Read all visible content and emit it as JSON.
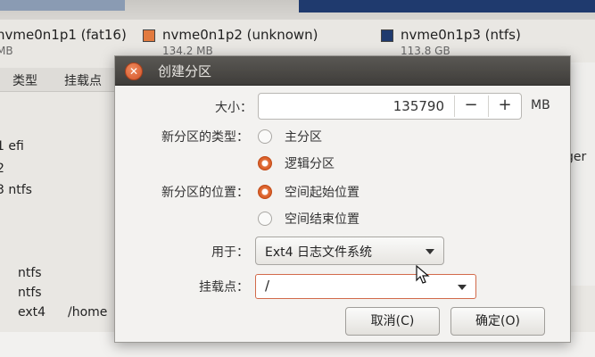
{
  "background": {
    "legend": [
      {
        "name": "nvme0n1p1 (fat16)",
        "size": "MB",
        "color": ""
      },
      {
        "name": "nvme0n1p2 (unknown)",
        "size": "134.2 MB",
        "color": "#e27a3f"
      },
      {
        "name": "nvme0n1p3 (ntfs)",
        "size": "113.8 GB",
        "color": "#1f3a6e"
      }
    ],
    "columns": [
      "类型",
      "挂载点"
    ],
    "rows_top": [
      "1 efi",
      "2",
      "3 ntfs"
    ],
    "rows_bottom": [
      {
        "type": "ntfs",
        "mount": ""
      },
      {
        "type": "ntfs",
        "mount": ""
      },
      {
        "type": "ext4",
        "mount": "/home"
      }
    ],
    "right_text": "ger"
  },
  "dialog": {
    "title": "创建分区",
    "close_icon": "close-icon",
    "size_label": "大小：",
    "size_value": "135790",
    "size_unit": "MB",
    "minus": "−",
    "plus": "+",
    "type_label": "新分区的类型：",
    "type_options": [
      {
        "label": "主分区",
        "selected": false
      },
      {
        "label": "逻辑分区",
        "selected": true
      }
    ],
    "location_label": "新分区的位置：",
    "location_options": [
      {
        "label": "空间起始位置",
        "selected": true
      },
      {
        "label": "空间结束位置",
        "selected": false
      }
    ],
    "use_label": "用于：",
    "use_value": "Ext4 日志文件系统",
    "mount_label": "挂载点：",
    "mount_value": "/",
    "cancel_button": "取消(C)",
    "ok_button": "确定(O)",
    "accent_color": "#d3551f"
  }
}
